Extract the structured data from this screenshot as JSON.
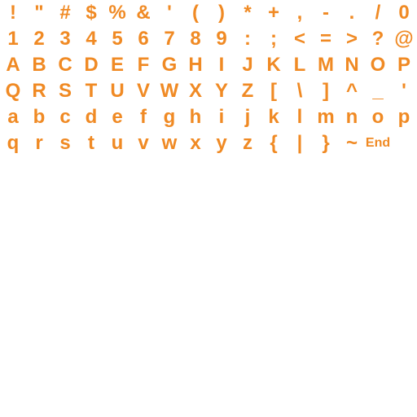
{
  "palette": {
    "glyph_color": "#f08a24",
    "background": "#ffffff"
  },
  "font_sheet": {
    "rows": [
      [
        "!",
        "\"",
        "#",
        "$",
        "%",
        "&",
        "'",
        "(",
        ")",
        "*",
        "+",
        ",",
        "-",
        ".",
        "/",
        "0"
      ],
      [
        "1",
        "2",
        "3",
        "4",
        "5",
        "6",
        "7",
        "8",
        "9",
        ":",
        ";",
        "<",
        "=",
        ">",
        "?",
        "@"
      ],
      [
        "A",
        "B",
        "C",
        "D",
        "E",
        "F",
        "G",
        "H",
        "I",
        "J",
        "K",
        "L",
        "M",
        "N",
        "O",
        "P"
      ],
      [
        "Q",
        "R",
        "S",
        "T",
        "U",
        "V",
        "W",
        "X",
        "Y",
        "Z",
        "[",
        "\\",
        "]",
        "^",
        "_",
        "'"
      ],
      [
        "a",
        "b",
        "c",
        "d",
        "e",
        "f",
        "g",
        "h",
        "i",
        "j",
        "k",
        "l",
        "m",
        "n",
        "o",
        "p"
      ],
      [
        "q",
        "r",
        "s",
        "t",
        "u",
        "v",
        "w",
        "x",
        "y",
        "z",
        "{",
        "|",
        "}",
        "~",
        "End"
      ]
    ]
  }
}
